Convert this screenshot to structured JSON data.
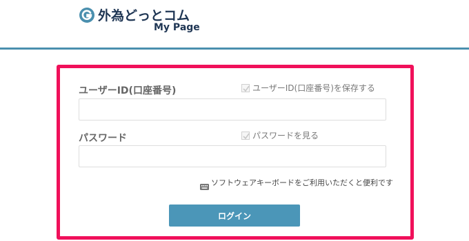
{
  "header": {
    "brand_name": "外為どっとコム",
    "brand_sub": "My Page",
    "logo_icon": "gaitame-logo-icon",
    "accent_color": "#4a8fae"
  },
  "login": {
    "border_color": "#f0105a",
    "user_id_label": "ユーザーID(口座番号)",
    "save_user_id_label": "ユーザーID(口座番号)を保存する",
    "save_user_id_checked": true,
    "user_id_value": "",
    "password_label": "パスワード",
    "show_password_label": "パスワードを見る",
    "show_password_checked": true,
    "password_value": "",
    "soft_keyboard_icon": "keyboard-icon",
    "soft_keyboard_label": "ソフトウェアキーボードをご利用いただくと便利です",
    "login_button_label": "ログイン",
    "button_color": "#4b96b8"
  }
}
